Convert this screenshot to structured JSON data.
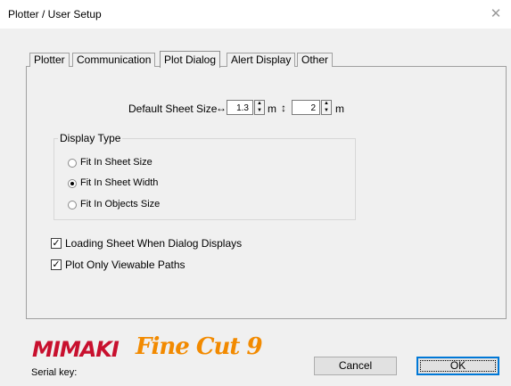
{
  "window": {
    "title": "Plotter / User Setup",
    "close_glyph": "✕"
  },
  "tabs": [
    {
      "label": "Plotter",
      "active": false
    },
    {
      "label": "Communication",
      "active": false
    },
    {
      "label": "Plot Dialog",
      "active": true
    },
    {
      "label": "Alert Display",
      "active": false
    },
    {
      "label": "Other",
      "active": false
    }
  ],
  "sheet_size": {
    "label": "Default Sheet Size",
    "width_arrow": "↔",
    "width_value": "1.3",
    "width_unit": "m",
    "height_arrow": "↕",
    "height_value": "2",
    "height_unit": "m"
  },
  "display_type": {
    "label": "Display Type",
    "options": [
      {
        "label": "Fit In Sheet Size",
        "checked": false
      },
      {
        "label": "Fit In Sheet Width",
        "checked": true
      },
      {
        "label": "Fit In Objects Size",
        "checked": false
      }
    ]
  },
  "checkboxes": [
    {
      "label": "Loading Sheet When Dialog Displays",
      "checked": true
    },
    {
      "label": "Plot Only Viewable Paths",
      "checked": true
    }
  ],
  "logo": {
    "brand": "MIMAKI",
    "product": "Fine Cut 9"
  },
  "serial_key_label": "Serial key:",
  "buttons": {
    "cancel": "Cancel",
    "ok": "OK"
  },
  "colors": {
    "mimaki_red": "#c8102e",
    "finecut_orange": "#f28a00",
    "focus_blue": "#0078d7"
  }
}
